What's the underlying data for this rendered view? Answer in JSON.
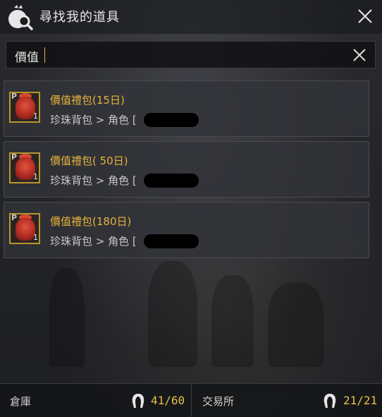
{
  "header": {
    "title": "尋找我的道具",
    "icon": "bag-search-icon"
  },
  "search": {
    "value": "價值"
  },
  "results": [
    {
      "name": "價值禮包(15日)",
      "location": "珍珠背包 > 角色 [",
      "grade": "P",
      "quantity": "1"
    },
    {
      "name": "價值禮包( 50日)",
      "location": "珍珠背包 > 角色 [",
      "grade": "P",
      "quantity": "1"
    },
    {
      "name": "價值禮包(180日)",
      "location": "珍珠背包 > 角色 [",
      "grade": "P",
      "quantity": "1"
    }
  ],
  "footer": {
    "warehouse": {
      "label": "倉庫",
      "count": "41/60"
    },
    "market": {
      "label": "交易所",
      "count": "21/21"
    }
  },
  "colors": {
    "accent": "#e3b23c",
    "count": "#e3c04a",
    "panel": "#2b2c30"
  }
}
